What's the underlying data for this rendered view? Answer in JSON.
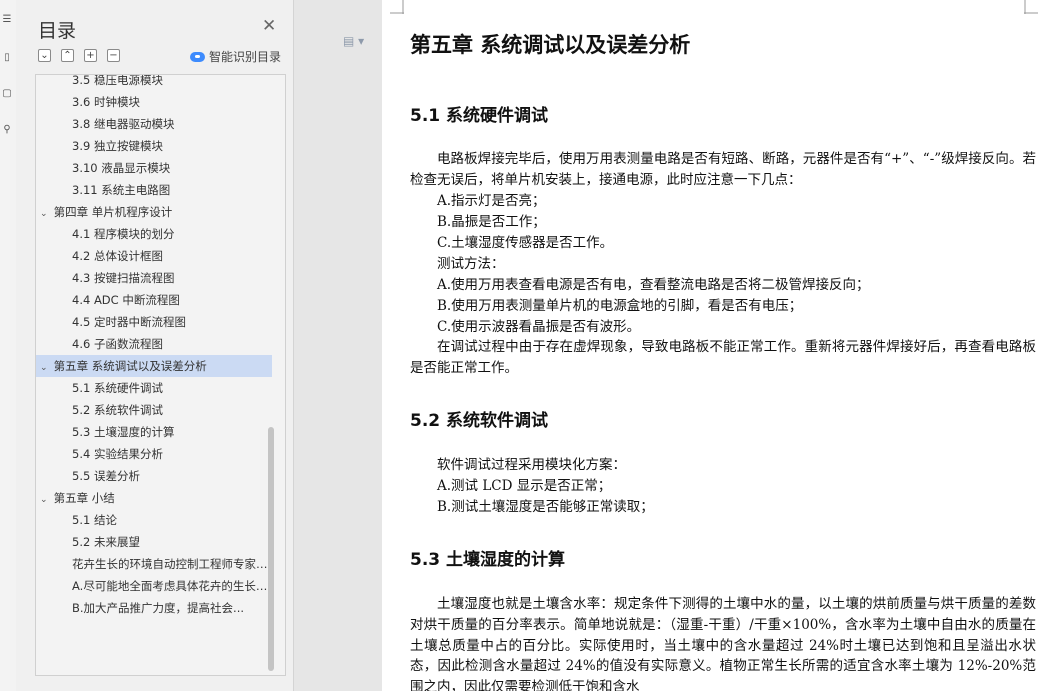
{
  "sidebar": {
    "title": "目录",
    "close_icon": "close-icon",
    "controls": [
      "collapse-all-icon",
      "expand-up-icon",
      "expand-plus-icon",
      "collapse-minus-icon"
    ],
    "smart_label": "智能识别目录",
    "items": [
      {
        "label": "3.5 稳压电源模块"
      },
      {
        "label": "3.6 时钟模块"
      },
      {
        "label": "3.8 继电器驱动模块"
      },
      {
        "label": "3.9 独立按键模块"
      },
      {
        "label": "3.10 液晶显示模块"
      },
      {
        "label": "3.11 系统主电路图"
      },
      {
        "label": "第四章 单片机程序设计"
      },
      {
        "label": "4.1 程序模块的划分"
      },
      {
        "label": "4.2 总体设计框图"
      },
      {
        "label": "4.3 按键扫描流程图"
      },
      {
        "label": "4.4 ADC 中断流程图"
      },
      {
        "label": "4.5  定时器中断流程图"
      },
      {
        "label": "4.6 子函数流程图"
      },
      {
        "label": "第五章  系统调试以及误差分析"
      },
      {
        "label": "5.1  系统硬件调试"
      },
      {
        "label": "5.2  系统软件调试"
      },
      {
        "label": "5.3 土壤湿度的计算"
      },
      {
        "label": "5.4 实验结果分析"
      },
      {
        "label": "5.5 误差分析"
      },
      {
        "label": "第五章  小结"
      },
      {
        "label": "5.1 结论"
      },
      {
        "label": "5.2  未来展望"
      },
      {
        "label": "花卉生长的环境自动控制工程师专家系统设计..."
      },
      {
        "label": "A.尽可能地全面考虑具体花卉的生长条件..."
      },
      {
        "label": "B.加大产品推广力度，提高社会..."
      }
    ]
  },
  "document": {
    "chapter_title": "第五章  系统调试以及误差分析",
    "s1_title": "5.1  系统硬件调试",
    "s1_p1": "电路板焊接完毕后，使用万用表测量电路是否有短路、断路，元器件是否有“+”、“-”级焊接反向。若检查无误后，将单片机安装上，接通电源，此时应注意一下几点：",
    "s1_a": "A.指示灯是否亮；",
    "s1_b": "B.晶振是否工作；",
    "s1_c": "C.土壤湿度传感器是否工作。",
    "s1_method": "测试方法：",
    "s1_ma": "A.使用万用表查看电源是否有电，查看整流电路是否将二极管焊接反向；",
    "s1_mb": "B.使用万用表测量单片机的电源盒地的引脚，看是否有电压；",
    "s1_mc": "C.使用示波器看晶振是否有波形。",
    "s1_p2": "在调试过程中由于存在虚焊现象，导致电路板不能正常工作。重新将元器件焊接好后，再查看电路板是否能正常工作。",
    "s2_title": "5.2  系统软件调试",
    "s2_p1": "软件调试过程采用模块化方案：",
    "s2_a": "A.测试 LCD 显示是否正常；",
    "s2_b": "B.测试土壤湿度是否能够正常读取；",
    "s3_title": "5.3 土壤湿度的计算",
    "s3_p1": "土壤湿度也就是土壤含水率：规定条件下测得的土壤中水的量，以土壤的烘前质量与烘干质量的差数对烘干质量的百分率表示。简单地说就是：（湿重-干重）/干重×100%，含水率为土壤中自由水的质量在土壤总质量中占的百分比。实际使用时，当土壤中的含水量超过 24%时土壤已达到饱和且呈溢出水状态，因此检测含水量超过 24%的值没有实际意义。植物正常生长所需的适宜含水率土壤为 12%-20%范围之内，因此仅需要检测低于饱和含水"
  }
}
